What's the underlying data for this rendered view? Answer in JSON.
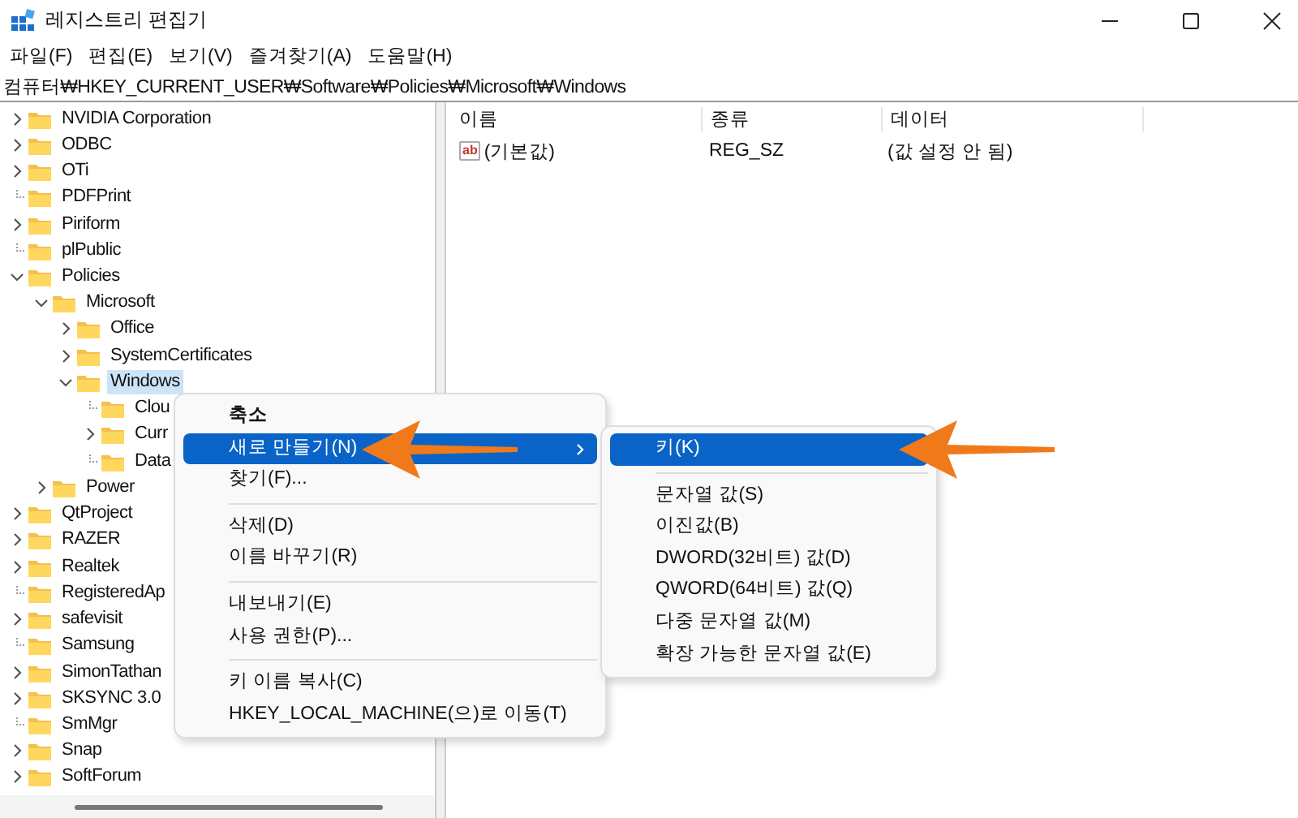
{
  "window": {
    "title": "레지스트리 편집기"
  },
  "menu_bar": [
    "파일(F)",
    "편집(E)",
    "보기(V)",
    "즐겨찾기(A)",
    "도움말(H)"
  ],
  "address": "컴퓨터₩HKEY_CURRENT_USER₩Software₩Policies₩Microsoft₩Windows",
  "tree": [
    {
      "label": "NVIDIA Corporation",
      "expanded": false,
      "selected": false
    },
    {
      "label": "ODBC",
      "expanded": false,
      "selected": false
    },
    {
      "label": "OTi",
      "expanded": false,
      "selected": false
    },
    {
      "label": "PDFPrint",
      "selected": false
    },
    {
      "label": "Piriform",
      "expanded": false,
      "selected": false
    },
    {
      "label": "plPublic",
      "selected": false
    },
    {
      "label": "Policies",
      "expanded": true,
      "selected": false,
      "children": [
        {
          "label": "Microsoft",
          "expanded": true,
          "selected": false,
          "children": [
            {
              "label": "Office",
              "expanded": false,
              "selected": false
            },
            {
              "label": "SystemCertificates",
              "expanded": false,
              "selected": false
            },
            {
              "label": "Windows",
              "expanded": true,
              "selected": true,
              "children": [
                {
                  "label": "Clou",
                  "selected": false
                },
                {
                  "label": "Curr",
                  "expanded": false,
                  "selected": false
                },
                {
                  "label": "Data",
                  "selected": false
                }
              ]
            }
          ]
        },
        {
          "label": "Power",
          "expanded": false,
          "selected": false
        }
      ]
    },
    {
      "label": "QtProject",
      "expanded": false,
      "selected": false
    },
    {
      "label": "RAZER",
      "expanded": false,
      "selected": false
    },
    {
      "label": "Realtek",
      "expanded": false,
      "selected": false
    },
    {
      "label": "RegisteredAp",
      "selected": false
    },
    {
      "label": "safevisit",
      "expanded": false,
      "selected": false
    },
    {
      "label": "Samsung",
      "selected": false
    },
    {
      "label": "SimonTathan",
      "expanded": false,
      "selected": false
    },
    {
      "label": "SKSYNC 3.0",
      "expanded": false,
      "selected": false
    },
    {
      "label": "SmMgr",
      "selected": false
    },
    {
      "label": "Snap",
      "expanded": false,
      "selected": false
    },
    {
      "label": "SoftForum",
      "expanded": false,
      "selected": false
    }
  ],
  "values_table": {
    "columns": [
      "이름",
      "종류",
      "데이터"
    ],
    "rows": [
      {
        "icon_text": "ab",
        "name": "(기본값)",
        "type": "REG_SZ",
        "data": "(값 설정 안 됨)"
      }
    ]
  },
  "context_menu": [
    {
      "kind": "item",
      "label": "축소",
      "default": true,
      "selected": false
    },
    {
      "kind": "item",
      "label": "새로 만들기(N)",
      "selected": true,
      "submenu": true,
      "pointer": true
    },
    {
      "kind": "item",
      "label": "찾기(F)...",
      "selected": false
    },
    {
      "kind": "separator"
    },
    {
      "kind": "item",
      "label": "삭제(D)",
      "selected": false
    },
    {
      "kind": "item",
      "label": "이름 바꾸기(R)",
      "selected": false
    },
    {
      "kind": "separator"
    },
    {
      "kind": "item",
      "label": "내보내기(E)",
      "selected": false
    },
    {
      "kind": "item",
      "label": "사용 권한(P)...",
      "selected": false
    },
    {
      "kind": "separator"
    },
    {
      "kind": "item",
      "label": "키 이름 복사(C)",
      "selected": false
    },
    {
      "kind": "item",
      "label": "HKEY_LOCAL_MACHINE(으)로 이동(T)",
      "selected": false
    }
  ],
  "submenu": [
    {
      "kind": "item",
      "label": "키(K)",
      "selected": true,
      "pointer": true
    },
    {
      "kind": "separator"
    },
    {
      "kind": "item",
      "label": "문자열 값(S)",
      "selected": false
    },
    {
      "kind": "item",
      "label": "이진값(B)",
      "selected": false
    },
    {
      "kind": "item",
      "label": "DWORD(32비트) 값(D)",
      "selected": false
    },
    {
      "kind": "item",
      "label": "QWORD(64비트) 값(Q)",
      "selected": false
    },
    {
      "kind": "item",
      "label": "다중 문자열 값(M)",
      "selected": false
    },
    {
      "kind": "item",
      "label": "확장 가능한 문자열 값(E)",
      "selected": false
    }
  ]
}
